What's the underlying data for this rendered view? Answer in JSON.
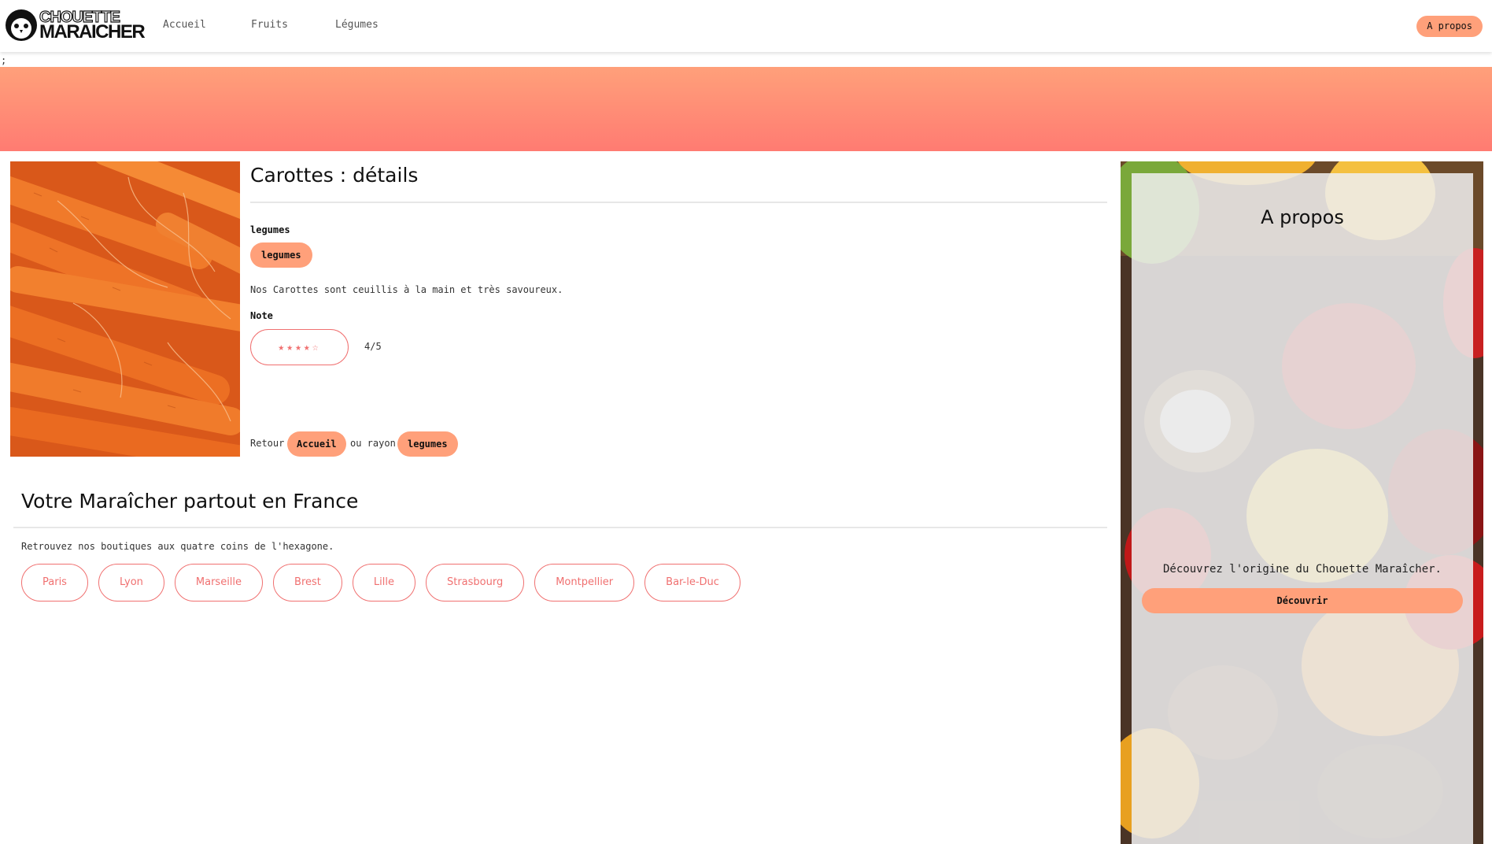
{
  "brand": {
    "line1": "CHOUETTE",
    "line2": "MARAICHER"
  },
  "nav": {
    "items": [
      "Accueil",
      "Fruits",
      "Légumes"
    ],
    "apropos": "A propos"
  },
  "stray_char": ";",
  "colors": {
    "accent": "#ffa07a",
    "outline": "#f07070",
    "hero_from": "#ffa07a",
    "hero_to": "#ff7b72"
  },
  "product": {
    "title": "Carottes : détails",
    "category_label": "legumes",
    "category_pill": "legumes",
    "description": "Nos Carottes sont ceuillis à la main et très savoureux.",
    "note_label": "Note",
    "stars": "★★★★☆",
    "rating_value": 4,
    "rating_max": 5,
    "rating_text": "4/5",
    "back_retour": "Retour",
    "back_accueil": "Accueil",
    "back_ou": "ou rayon",
    "back_legumes": "legumes"
  },
  "cities": {
    "title": "Votre Maraîcher partout en France",
    "description": "Retrouvez nos boutiques aux quatre coins de l'hexagone.",
    "items": [
      "Paris",
      "Lyon",
      "Marseille",
      "Brest",
      "Lille",
      "Strasbourg",
      "Montpellier",
      "Bar-le-Duc"
    ]
  },
  "sidebar": {
    "title": "A propos",
    "text": "Découvrez l'origine du Chouette Maraîcher.",
    "button": "Découvrir"
  }
}
